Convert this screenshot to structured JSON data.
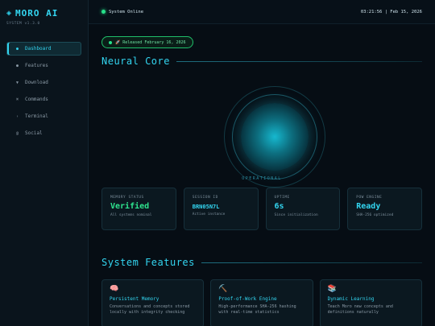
{
  "brand": {
    "symbol": "◈",
    "name": "MORO AI",
    "version": "SYSTEM v1.3.0"
  },
  "nav": [
    {
      "label": "Dashboard",
      "icon": "●",
      "icon_name": "dot-icon",
      "active": true
    },
    {
      "label": "Features",
      "icon": "●",
      "icon_name": "dot-icon",
      "active": false
    },
    {
      "label": "Download",
      "icon": "▼",
      "icon_name": "download-icon",
      "active": false
    },
    {
      "label": "Commands",
      "icon": "⌘",
      "icon_name": "command-icon",
      "active": false
    },
    {
      "label": "Terminal",
      "icon": "›",
      "icon_name": "terminal-icon",
      "active": false
    },
    {
      "label": "Social",
      "icon": "@",
      "icon_name": "at-icon",
      "active": false
    }
  ],
  "topbar": {
    "status": "System Online",
    "clock": "03:21:56 | Feb 15, 2026"
  },
  "release": {
    "text": "🚀 Released February 16, 2026"
  },
  "core": {
    "title": "Neural Core",
    "state": "OPERATIONAL"
  },
  "stats": [
    {
      "label": "MEMORY STATUS",
      "value": "Verified",
      "sub": "All systems nominal",
      "color": "#2ee38e"
    },
    {
      "label": "SESSION ID",
      "value": "BRN05N7L",
      "sub": "Active instance",
      "color": "#33d5f0"
    },
    {
      "label": "UPTIME",
      "value": "6s",
      "sub": "Since initialization",
      "color": "#33d5f0"
    },
    {
      "label": "POW ENGINE",
      "value": "Ready",
      "sub": "SHA-256 optimized",
      "color": "#33d5f0"
    }
  ],
  "features": {
    "title": "System Features",
    "items": [
      {
        "icon": "🧠",
        "icon_name": "brain-icon",
        "title": "Persistent Memory",
        "desc": "Conversations and concepts stored locally with integrity checking"
      },
      {
        "icon": "⛏️",
        "icon_name": "pickaxe-icon",
        "title": "Proof-of-Work Engine",
        "desc": "High-performance SHA-256 hashing with real-time statistics"
      },
      {
        "icon": "📚",
        "icon_name": "books-icon",
        "title": "Dynamic Learning",
        "desc": "Teach Moro new concepts and definitions naturally"
      }
    ]
  },
  "colors": {
    "accent": "#33d5f0",
    "success": "#2ee38e",
    "background": "#060d14"
  }
}
